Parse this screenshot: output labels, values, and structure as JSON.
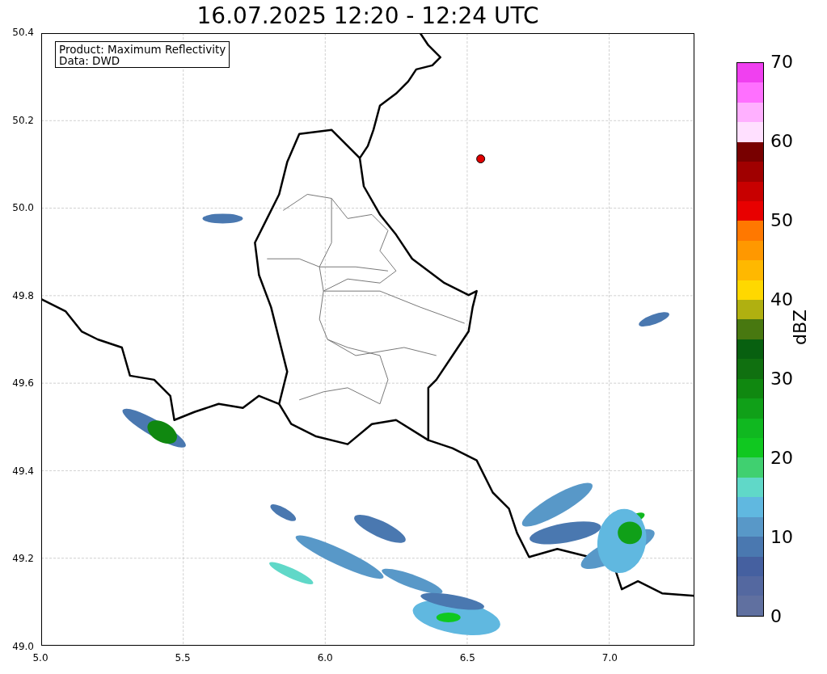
{
  "title": "16.07.2025 12:20 - 12:24 UTC",
  "info_box": {
    "lines": [
      "Product: Maximum Reflectivity",
      "Data: DWD"
    ]
  },
  "map": {
    "x_ticks": [
      "5.0",
      "5.5",
      "6.0",
      "6.5",
      "7.0"
    ],
    "y_ticks": [
      "50.4",
      "50.2",
      "50.0",
      "49.8",
      "49.6",
      "49.4",
      "49.2",
      "49.0"
    ]
  },
  "colorbar": {
    "label": "dBZ",
    "ticks": [
      "70",
      "60",
      "50",
      "40",
      "30",
      "20",
      "10",
      "0"
    ],
    "segments": [
      {
        "color": "#6070a0"
      },
      {
        "color": "#5468a0"
      },
      {
        "color": "#4560a0"
      },
      {
        "color": "#4a78b0"
      },
      {
        "color": "#5898c8"
      },
      {
        "color": "#60b8e0"
      },
      {
        "color": "#60d8c8"
      },
      {
        "color": "#40d070"
      },
      {
        "color": "#10c820"
      },
      {
        "color": "#10b820"
      },
      {
        "color": "#10a018"
      },
      {
        "color": "#108810"
      },
      {
        "color": "#107010"
      },
      {
        "color": "#086010"
      },
      {
        "color": "#487810"
      },
      {
        "color": "#b0b010"
      },
      {
        "color": "#ffd800"
      },
      {
        "color": "#ffb800"
      },
      {
        "color": "#ff9800"
      },
      {
        "color": "#ff7800"
      },
      {
        "color": "#e80000"
      },
      {
        "color": "#c80000"
      },
      {
        "color": "#a00000"
      },
      {
        "color": "#780000"
      },
      {
        "color": "#ffe0ff"
      },
      {
        "color": "#ffb0ff"
      },
      {
        "color": "#ff70ff"
      },
      {
        "color": "#f040f0"
      }
    ]
  }
}
